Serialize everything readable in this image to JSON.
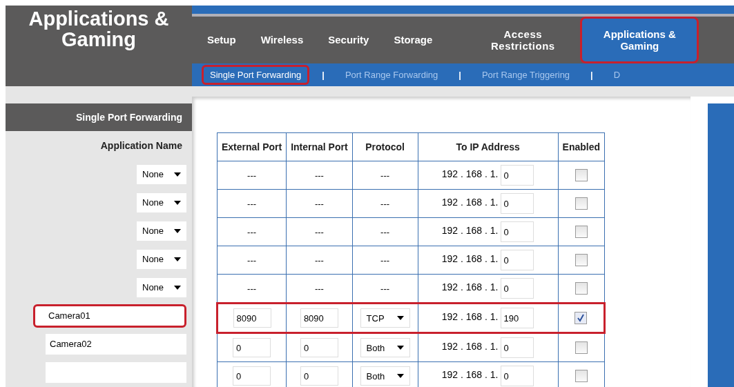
{
  "page_title": "Applications & Gaming",
  "tabs": [
    {
      "label": "Setup",
      "selected": false,
      "highlighted": false
    },
    {
      "label": "Wireless",
      "selected": false,
      "highlighted": false
    },
    {
      "label": "Security",
      "selected": false,
      "highlighted": false
    },
    {
      "label": "Storage",
      "selected": false,
      "highlighted": false
    },
    {
      "label": "Access Restrictions",
      "selected": false,
      "highlighted": false
    },
    {
      "label": "Applications & Gaming",
      "selected": true,
      "highlighted": true
    }
  ],
  "subnav": [
    {
      "kind": "link",
      "label": "Single Port Forwarding",
      "selected": true,
      "highlighted": true
    },
    {
      "kind": "separator",
      "label": "|"
    },
    {
      "kind": "link",
      "label": "Port Range Forwarding",
      "selected": false,
      "highlighted": false
    },
    {
      "kind": "separator",
      "label": "|"
    },
    {
      "kind": "link",
      "label": "Port Range Triggering",
      "selected": false,
      "highlighted": false
    },
    {
      "kind": "separator",
      "label": "|"
    },
    {
      "kind": "link",
      "label": "D",
      "selected": false,
      "highlighted": false
    }
  ],
  "sidebar": {
    "heading": "Single Port Forwarding",
    "column": "Application Name"
  },
  "table": {
    "columns": [
      "External Port",
      "Internal Port",
      "Protocol",
      "To IP Address",
      "Enabled"
    ],
    "rows": [
      {
        "kind": "preset",
        "app": "None",
        "external": "---",
        "internal": "---",
        "protocol": "---",
        "ip_prefix": "192 . 168 . 1.",
        "ip_last": "0",
        "enabled": false,
        "highlighted": false
      },
      {
        "kind": "preset",
        "app": "None",
        "external": "---",
        "internal": "---",
        "protocol": "---",
        "ip_prefix": "192 . 168 . 1.",
        "ip_last": "0",
        "enabled": false,
        "highlighted": false
      },
      {
        "kind": "preset",
        "app": "None",
        "external": "---",
        "internal": "---",
        "protocol": "---",
        "ip_prefix": "192 . 168 . 1.",
        "ip_last": "0",
        "enabled": false,
        "highlighted": false
      },
      {
        "kind": "preset",
        "app": "None",
        "external": "---",
        "internal": "---",
        "protocol": "---",
        "ip_prefix": "192 . 168 . 1.",
        "ip_last": "0",
        "enabled": false,
        "highlighted": false
      },
      {
        "kind": "preset",
        "app": "None",
        "external": "---",
        "internal": "---",
        "protocol": "---",
        "ip_prefix": "192 . 168 . 1.",
        "ip_last": "0",
        "enabled": false,
        "highlighted": false
      },
      {
        "kind": "custom",
        "app": "Camera01",
        "external": "8090",
        "internal": "8090",
        "protocol": "TCP",
        "ip_prefix": "192 . 168 . 1.",
        "ip_last": "190",
        "enabled": true,
        "highlighted": true
      },
      {
        "kind": "custom",
        "app": "Camera02",
        "external": "0",
        "internal": "0",
        "protocol": "Both",
        "ip_prefix": "192 . 168 . 1.",
        "ip_last": "0",
        "enabled": false,
        "highlighted": false
      },
      {
        "kind": "custom",
        "app": "",
        "external": "0",
        "internal": "0",
        "protocol": "Both",
        "ip_prefix": "192 . 168 . 1.",
        "ip_last": "0",
        "enabled": false,
        "highlighted": false
      }
    ]
  }
}
